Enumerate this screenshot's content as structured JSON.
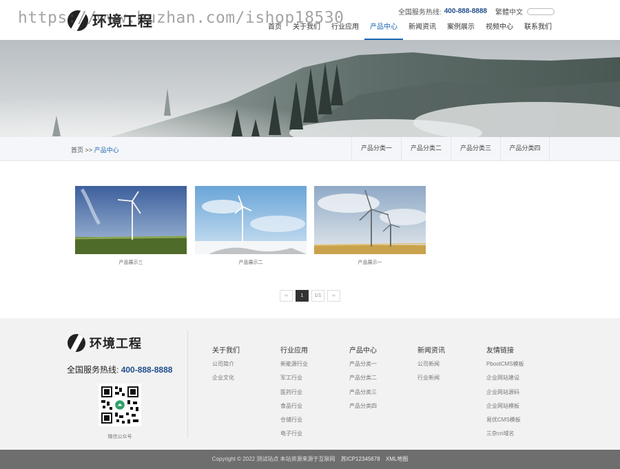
{
  "watermark": "https://www.huzhan.com/ishop18530",
  "header": {
    "brand": "环境工程",
    "hotline_label": "全国服务热线:",
    "hotline_number": "400-888-8888",
    "lang_switch": "繁體中文",
    "search_placeholder": ""
  },
  "nav": {
    "items": [
      {
        "label": "首页"
      },
      {
        "label": "关于我们"
      },
      {
        "label": "行业应用"
      },
      {
        "label": "产品中心"
      },
      {
        "label": "新闻资讯"
      },
      {
        "label": "案例展示"
      },
      {
        "label": "视频中心"
      },
      {
        "label": "联系我们"
      }
    ],
    "active": "产品中心"
  },
  "breadcrumb": {
    "home": "首页",
    "separator": ">>",
    "current": "产品中心"
  },
  "category_tabs": [
    {
      "label": "产品分类一"
    },
    {
      "label": "产品分类二"
    },
    {
      "label": "产品分类三"
    },
    {
      "label": "产品分类四"
    }
  ],
  "products": [
    {
      "title": "产品展示三"
    },
    {
      "title": "产品展示二"
    },
    {
      "title": "产品展示一"
    }
  ],
  "pager": {
    "prev": "‹‹",
    "current": "1",
    "info": "1/1",
    "next": "››"
  },
  "footer": {
    "brand": "环境工程",
    "hotline_label": "全国服务热线:",
    "hotline_number": "400-888-8888",
    "qr_caption": "微信公众号",
    "columns": [
      {
        "title": "关于我们",
        "links": [
          "公司简介",
          "企业文化"
        ]
      },
      {
        "title": "行业应用",
        "links": [
          "新能源行业",
          "军工行业",
          "医药行业",
          "食品行业",
          "仓储行业",
          "电子行业"
        ]
      },
      {
        "title": "产品中心",
        "links": [
          "产品分类一",
          "产品分类二",
          "产品分类三",
          "产品分类四"
        ]
      },
      {
        "title": "新闻资讯",
        "links": [
          "公司新闻",
          "行业新闻"
        ]
      },
      {
        "title": "友情链接",
        "links": [
          "PbootCMS模板",
          "企业网站建设",
          "企业网站源码",
          "企业网站模板",
          "易优CMS模板",
          "三杂cn域名"
        ]
      }
    ]
  },
  "copyright": {
    "text": "Copyright © 2022 测试站点 本站资源来源于互联网",
    "icp": "苏ICP12345678",
    "sitemap": "XML地图"
  },
  "colors": {
    "accent": "#1a66b3",
    "hotline": "#1e4d8c",
    "footer_bg": "#f2f2f2",
    "copyright_bg": "#6e6e6e"
  }
}
